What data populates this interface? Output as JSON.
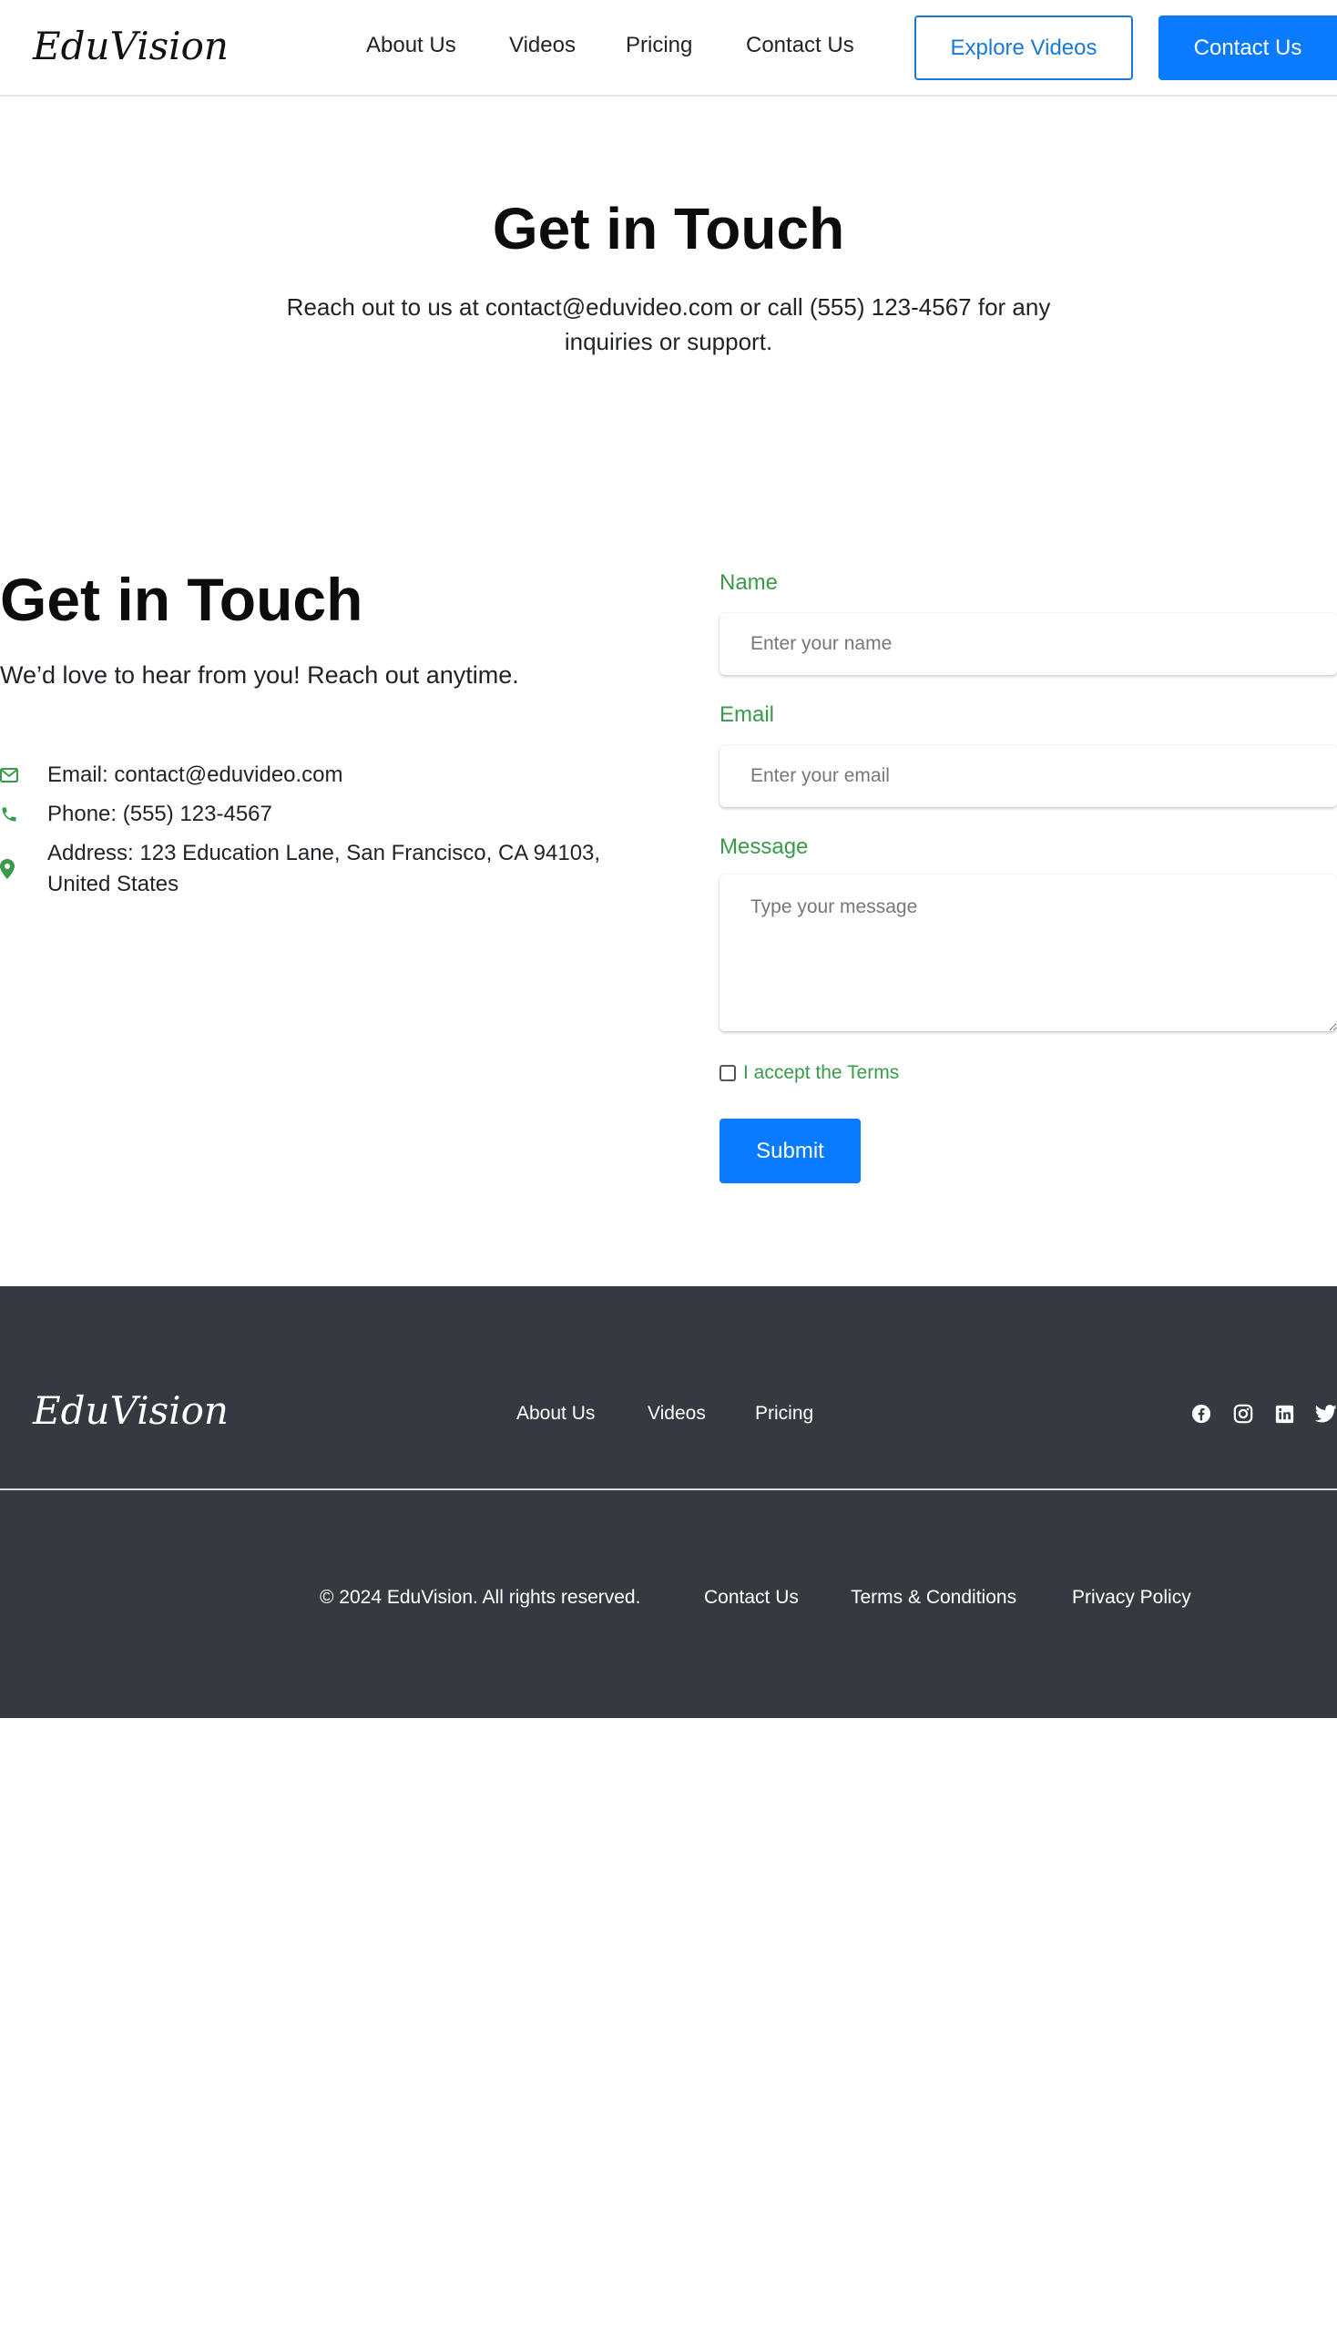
{
  "header": {
    "logo": "EduVision",
    "nav": [
      "About Us",
      "Videos",
      "Pricing",
      "Contact Us"
    ],
    "explore_button": "Explore Videos",
    "contact_button": "Contact Us"
  },
  "hero": {
    "title": "Get in Touch",
    "text": "Reach out to us at contact@eduvideo.com or call (555) 123-4567 for any inquiries or support."
  },
  "contact": {
    "title": "Get in Touch",
    "subtitle": "We’d love to hear from you! Reach out anytime.",
    "items": [
      {
        "icon": "envelope-icon",
        "text": "Email: contact@eduvideo.com"
      },
      {
        "icon": "phone-icon",
        "text": "Phone: (555) 123-4567"
      },
      {
        "icon": "map-pin-icon",
        "text": "Address: 123 Education Lane, San Francisco, CA 94103, United States"
      }
    ],
    "accent_color": "#3a9a4a"
  },
  "form": {
    "name_label": "Name",
    "name_placeholder": "Enter your name",
    "email_label": "Email",
    "email_placeholder": "Enter your email",
    "message_label": "Message",
    "message_placeholder": "Type your message",
    "terms_label": "I accept the Terms",
    "terms_checked": false,
    "submit_label": "Submit"
  },
  "footer": {
    "logo": "EduVision",
    "nav": [
      "About Us",
      "Videos",
      "Pricing"
    ],
    "social": [
      "facebook-icon",
      "instagram-icon",
      "linkedin-icon",
      "twitter-icon"
    ],
    "copyright": "© 2024 EduVision. All rights reserved.",
    "links": [
      "Contact Us",
      "Terms & Conditions",
      "Privacy Policy"
    ],
    "background": "#353940"
  },
  "colors": {
    "primary": "#0a7bff",
    "outline": "#1a78d6",
    "label_green": "#3a9a4a"
  }
}
